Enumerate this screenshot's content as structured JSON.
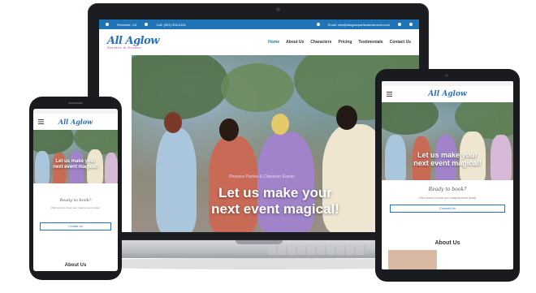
{
  "laptop": {
    "topbar": {
      "location": "Riverside, CA",
      "call": "Call: (951) 534-9161",
      "email": "Email: info@allaglowpartiesandevents.com"
    },
    "logo": {
      "main": "All Aglow",
      "sub": "Parties & Events"
    },
    "nav": [
      "Home",
      "About Us",
      "Characters",
      "Pricing",
      "Testimonials",
      "Contact Us"
    ],
    "hero": {
      "tagline": "Princess Parties & Character Events",
      "title_line1": "Let us make your",
      "title_line2": "next event magical!"
    }
  },
  "tablet": {
    "logo": "All Aglow",
    "hero": {
      "line1": "Let us make your",
      "line2": "next event magical!"
    },
    "ready": "Ready to book?",
    "ready_text": "Click below to book your magical event today!",
    "button": "Contact Us",
    "about": "About Us"
  },
  "phone": {
    "logo": "All Aglow",
    "hero": {
      "line1": "Let us make your",
      "line2": "next event magical!"
    },
    "ready": "Ready to book?",
    "ready_text": "Click below to book your magical event today!",
    "button": "Contact Us",
    "about": "About Us"
  },
  "colors": {
    "brand_blue": "#1f73b7",
    "logo_blue": "#2b6fc0",
    "logo_pink": "#c47ab8",
    "device_frame": "#1a1b1e"
  },
  "icons": [
    "camera-icon",
    "menu-icon",
    "phone-icon",
    "email-icon",
    "location-icon",
    "social-icon"
  ]
}
